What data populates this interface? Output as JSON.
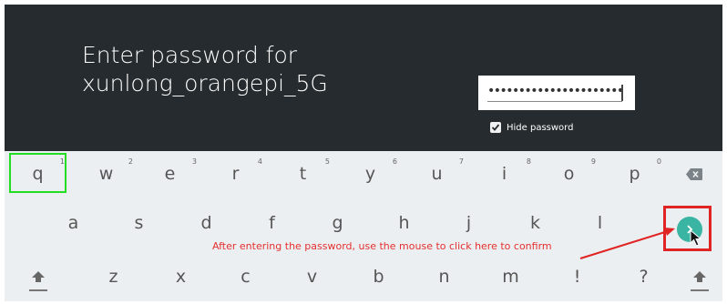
{
  "prompt": {
    "line1": "Enter password for",
    "line2": "xunlong_orangepi_5G"
  },
  "password_field": {
    "value": "••••••••••••••••••••••••"
  },
  "hide_password": {
    "label": "Hide password",
    "checked": true
  },
  "keyboard": {
    "row1": [
      {
        "label": "q",
        "hint": "1"
      },
      {
        "label": "w",
        "hint": "2"
      },
      {
        "label": "e",
        "hint": "3"
      },
      {
        "label": "r",
        "hint": "4"
      },
      {
        "label": "t",
        "hint": "5"
      },
      {
        "label": "y",
        "hint": "6"
      },
      {
        "label": "u",
        "hint": "7"
      },
      {
        "label": "i",
        "hint": "8"
      },
      {
        "label": "o",
        "hint": "9"
      },
      {
        "label": "p",
        "hint": "0"
      }
    ],
    "row2": [
      "a",
      "s",
      "d",
      "f",
      "g",
      "h",
      "j",
      "k",
      "l"
    ],
    "row3": [
      "z",
      "x",
      "c",
      "v",
      "b",
      "n",
      "m",
      "!",
      "?"
    ],
    "backspace_icon": "backspace-icon",
    "enter_icon": "chevron-right-icon",
    "shift_icon": "shift-icon"
  },
  "annotation": {
    "text": "After entering the password, use the mouse to click here to confirm",
    "color": "#e53030"
  },
  "colors": {
    "background_dark": "#252b2f",
    "keyboard_bg": "#eceff1",
    "accent": "#3bb5a3",
    "highlight_green": "#22dd22",
    "highlight_red": "#e02424"
  }
}
